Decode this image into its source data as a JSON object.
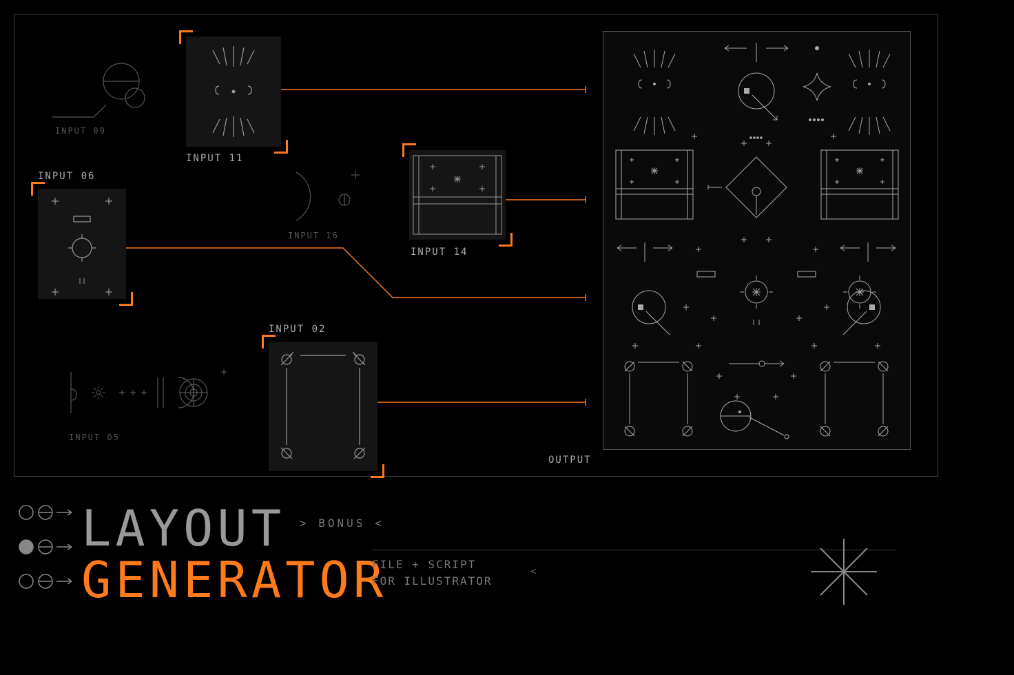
{
  "inputs": {
    "i02": "INPUT 02",
    "i05": "INPUT 05",
    "i06": "INPUT 06",
    "i09": "INPUT 09",
    "i11": "INPUT 11",
    "i14": "INPUT 14",
    "i16": "INPUT 16"
  },
  "output_label": "OUTPUT",
  "title_line1": "LAYOUT",
  "title_line2": "GENERATOR",
  "bonus": ">  BONUS  <",
  "sub1": "FILE + SCRIPT",
  "sub2": "FOR ILLUSTRATOR",
  "sub_caret": "<"
}
